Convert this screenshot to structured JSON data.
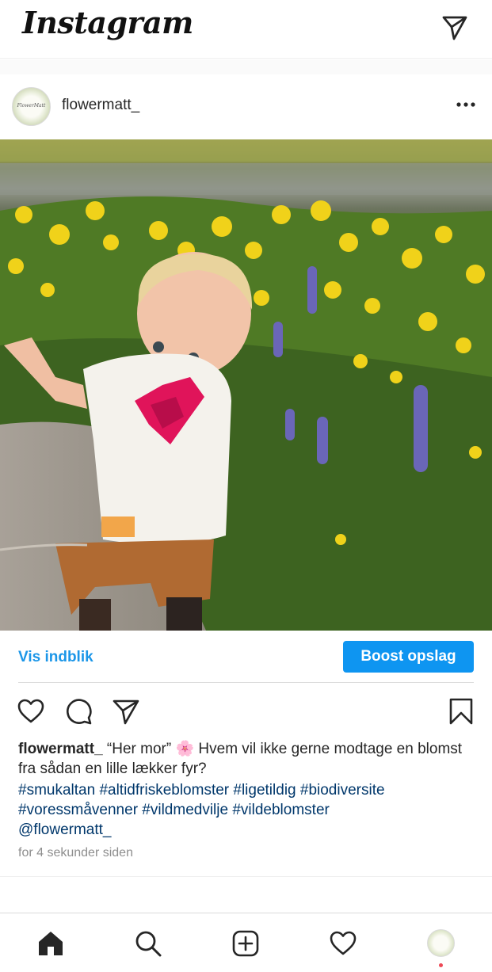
{
  "header": {
    "logo": "Instagram",
    "direct_icon": "paper-plane-icon"
  },
  "post": {
    "username": "flowermatt_",
    "avatar_text": "FlowerMatt",
    "more_icon": "more-horizontal-icon"
  },
  "insights": {
    "link_label": "Vis indblik",
    "boost_label": "Boost opslag"
  },
  "actions": {
    "like_icon": "heart-icon",
    "comment_icon": "comment-icon",
    "share_icon": "paper-plane-icon",
    "save_icon": "bookmark-icon"
  },
  "caption": {
    "username": "flowermatt_",
    "text": " “Her mor” 🌸 Hvem vil ikke gerne modtage en blomst fra sådan en lille lækker fyr?",
    "tags_line1": "#smukaltan #altidfriskeblomster #ligetildig #biodiversite",
    "tags_line2": "#voressmåvenner #vildmedvilje #vildeblomster",
    "tags_line3": "@flowermatt_",
    "timestamp": "for 4 sekunder siden"
  },
  "bottom_nav": {
    "items": [
      "home-icon",
      "search-icon",
      "new-post-icon",
      "activity-heart-icon",
      "profile-avatar"
    ]
  },
  "colors": {
    "link_blue": "#1b96e8",
    "button_blue": "#0e95f1",
    "hashtag_blue": "#00376b",
    "notification_red": "#ed4956"
  }
}
